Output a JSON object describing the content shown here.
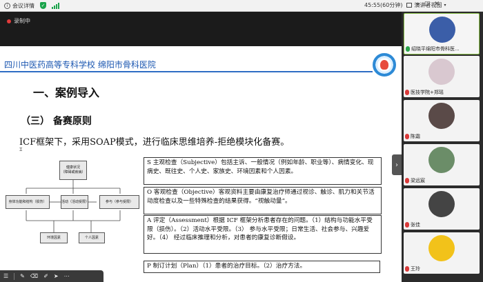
{
  "topbar": {
    "meeting_info_label": "会议详情",
    "timer": "45:55(60分钟)",
    "view_mode": "演讲者视图"
  },
  "recording": {
    "label": "录制中"
  },
  "slide": {
    "school": "四川中医药高等专科学校 绵阳市骨科医院",
    "heading1": "一、案例导入",
    "heading2": "（三）  备赛原则",
    "intro": "ICF框架下，采用SOAP模式，进行临床思维培养-拒绝模块化备赛。",
    "diagram": {
      "health": "健康状况",
      "health_sub": "（障碍或疾病）",
      "body": "身体功能和结构（损伤）",
      "activity": "活动（活动受限）",
      "participation": "参与（参与受限）",
      "env": "环境因素",
      "personal": "个人因素"
    },
    "soap": {
      "s": "S 主观检查（Subjective）包括主诉、一般情况（例如年龄、职业等）、病情变化、现病史、既往史、个人史、家族史、环境因素和个人因素。",
      "o": "O 客观检查（Objective）客观资料主要由康复治疗师通过视诊、触诊、肌力和关节活动度检查以及一些特殊检查的结果获得。“视触动量”。",
      "a": "A 评定（Assessment）根据 ICF 框架分析患者存在的问题。（1）结构与功能水平受限（损伤）。（2）活动水平受限。（3） 参与水平受限；日常生活、社会参与、兴趣爱好。（4） 经过临床推理和分析，对患者的康复诊断假设。",
      "p": "P 制订计划（Plan）（1）患者的治疗目标。（2）治疗方法。"
    }
  },
  "participants": [
    {
      "name": "绍晓平绵阳市骨科医...",
      "active": true,
      "avatar_color": "#3b5ea8"
    },
    {
      "name": "医技学院+郑瑶",
      "active": false,
      "avatar_color": "#d9c8d0"
    },
    {
      "name": "陈霜",
      "active": false,
      "avatar_color": "#5a4a48"
    },
    {
      "name": "梁远宸",
      "active": false,
      "avatar_color": "#6b8d68"
    },
    {
      "name": "张佳",
      "active": false,
      "avatar_color": "#444"
    },
    {
      "name": "王玲",
      "active": false,
      "avatar_color": "#f2c21a"
    }
  ]
}
